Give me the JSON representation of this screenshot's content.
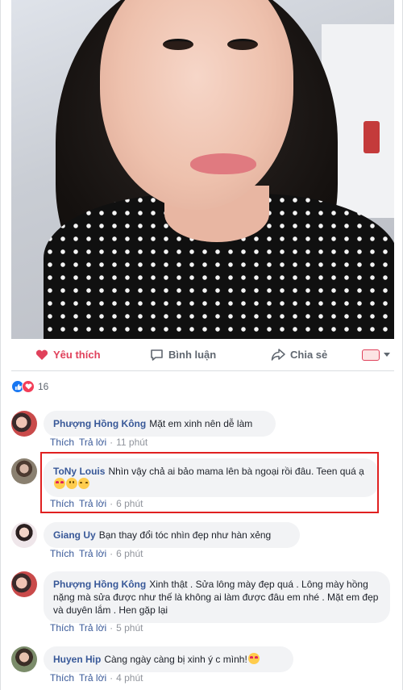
{
  "actions": {
    "like_label": "Yêu thích",
    "comment_label": "Bình luận",
    "share_label": "Chia sẻ",
    "like_color": "#e0415b"
  },
  "reactions": {
    "count": "16",
    "icons": [
      "like-reaction-icon",
      "love-reaction-icon"
    ]
  },
  "comments": [
    {
      "author": "Phượng Hồng Kông",
      "text": "Mặt em xinh nên dễ làm",
      "like": "Thích",
      "reply": "Trả lời",
      "time": "11 phút"
    },
    {
      "author": "ToNy Louis",
      "text": "Nhìn vậy chả ai bảo mama lên bà ngoại rồi đâu. Teen quá ạ",
      "like": "Thích",
      "reply": "Trả lời",
      "time": "6 phút",
      "emojis": [
        "heart-eyes-emoji",
        "grin-emoji",
        "smile-emoji"
      ],
      "highlighted": true
    },
    {
      "author": "Giang Uy",
      "text": "Bạn thay đổi tóc nhìn đẹp như hàn xẻng",
      "like": "Thích",
      "reply": "Trả lời",
      "time": "6 phút"
    },
    {
      "author": "Phượng Hồng Kông",
      "text": "Xinh thật . Sửa lông mày đẹp quá . Lông mày hồng nặng mà sửa được như thế là không ai làm được đâu em nhé . Mặt em đẹp và duyên lắm . Hen gặp lại",
      "like": "Thích",
      "reply": "Trả lời",
      "time": "5 phút"
    },
    {
      "author": "Huyen Hip",
      "text": "Càng ngày càng bị xinh ý c mình!",
      "like": "Thích",
      "reply": "Trả lời",
      "time": "4 phút",
      "emojis": [
        "heart-eyes-emoji"
      ]
    }
  ],
  "colors": {
    "link_blue": "#385898",
    "highlight_border": "#e02020"
  }
}
